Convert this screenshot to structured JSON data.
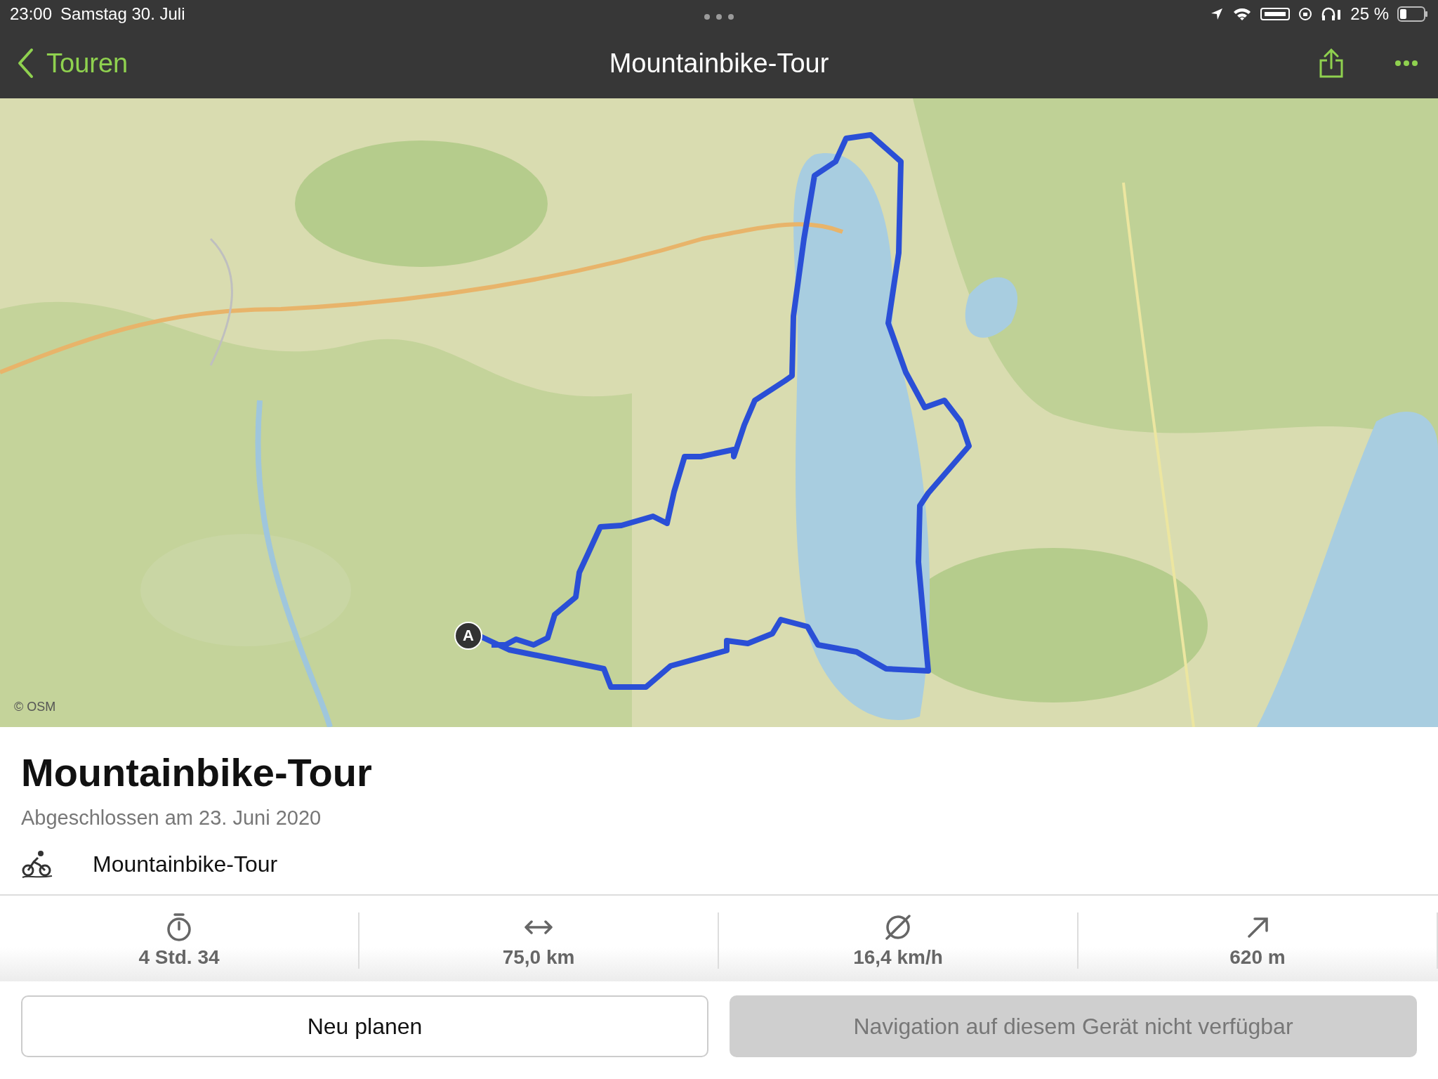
{
  "status_bar": {
    "time": "23:00",
    "date": "Samstag 30. Juli",
    "battery": "25 %"
  },
  "nav": {
    "back": "Touren",
    "title": "Mountainbike-Tour"
  },
  "map": {
    "start_marker": "A",
    "attribution": "© OSM"
  },
  "tour": {
    "title": "Mountainbike-Tour",
    "subtitle": "Abgeschlossen am 23. Juni 2020",
    "sport": "Mountainbike-Tour"
  },
  "stats": [
    {
      "kind": "duration",
      "value": "4 Std. 34"
    },
    {
      "kind": "distance",
      "value": "75,0 km"
    },
    {
      "kind": "speed",
      "value": "16,4 km/h"
    },
    {
      "kind": "ascent",
      "value": "620 m"
    }
  ],
  "buttons": [
    {
      "label": "Neu planen",
      "disabled": false
    },
    {
      "label": "Navigation auf diesem Gerät nicht verfügbar",
      "disabled": true
    }
  ]
}
